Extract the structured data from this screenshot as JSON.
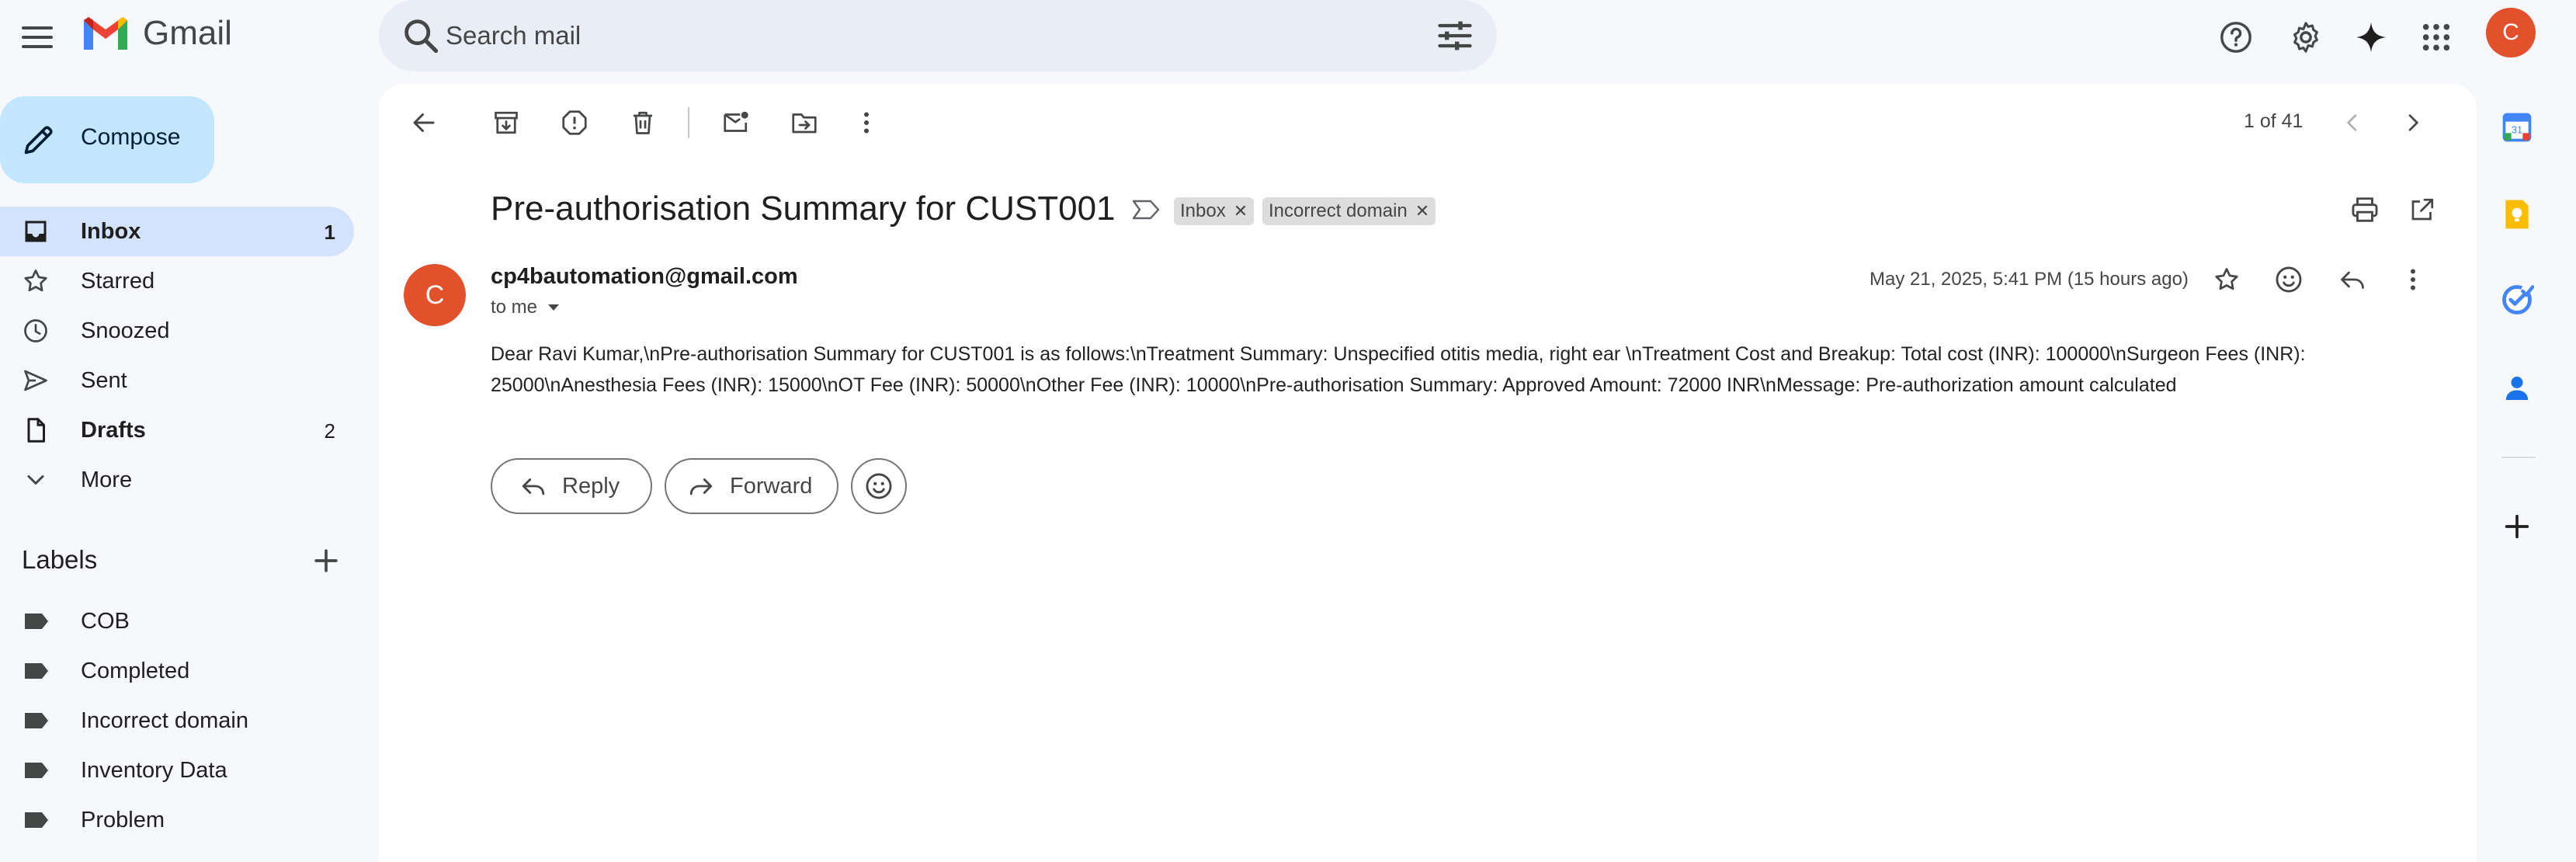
{
  "app": {
    "name": "Gmail"
  },
  "search": {
    "placeholder": "Search mail"
  },
  "user": {
    "initial": "C"
  },
  "compose": {
    "label": "Compose"
  },
  "nav": [
    {
      "label": "Inbox",
      "count": "1",
      "icon": "inbox-icon"
    },
    {
      "label": "Starred",
      "count": "",
      "icon": "star-icon"
    },
    {
      "label": "Snoozed",
      "count": "",
      "icon": "clock-icon"
    },
    {
      "label": "Sent",
      "count": "",
      "icon": "send-icon"
    },
    {
      "label": "Drafts",
      "count": "2",
      "icon": "draft-icon"
    },
    {
      "label": "More",
      "count": "",
      "icon": "chevron-down-icon"
    }
  ],
  "labels": {
    "title": "Labels",
    "items": [
      "COB",
      "Completed",
      "Incorrect domain",
      "Inventory Data",
      "Problem"
    ]
  },
  "pager": {
    "text": "1 of 41"
  },
  "email": {
    "subject": "Pre-authorisation Summary for CUST001",
    "chips": [
      "Inbox",
      "Incorrect domain"
    ],
    "sender_initial": "C",
    "sender": "cp4bautomation@gmail.com",
    "to": "to me",
    "date": "May 21, 2025, 5:41 PM (15 hours ago)",
    "body": "Dear Ravi Kumar,\\nPre-authorisation Summary for CUST001 is as follows:\\nTreatment Summary: Unspecified otitis media, right ear \\nTreatment Cost and Breakup: Total cost (INR): 100000\\nSurgeon Fees (INR): 25000\\nAnesthesia Fees (INR): 15000\\nOT Fee (INR): 50000\\nOther Fee (INR): 10000\\nPre-authorisation Summary: Approved Amount: 72000 INR\\nMessage: Pre-authorization amount calculated"
  },
  "actions": {
    "reply": "Reply",
    "forward": "Forward"
  },
  "colors": {
    "accent": "#0b57d0",
    "compose_bg": "#c2e7ff",
    "active_nav": "#d3e3fd",
    "avatar": "#e2512b"
  }
}
